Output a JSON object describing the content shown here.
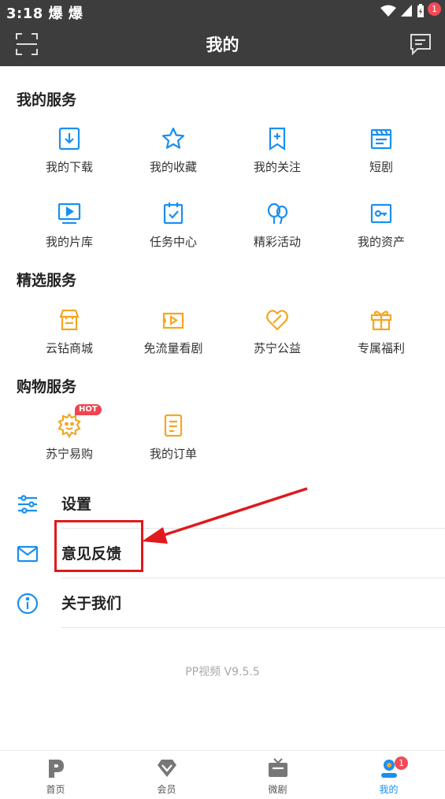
{
  "status_bar": {
    "time": "3:18",
    "notif_1": "爆",
    "notif_2": "爆"
  },
  "header": {
    "title": "我的",
    "message_badge": "1"
  },
  "services": {
    "title": "我的服务",
    "items": [
      {
        "label": "我的下载",
        "icon": "download-icon"
      },
      {
        "label": "我的收藏",
        "icon": "star-icon"
      },
      {
        "label": "我的关注",
        "icon": "bookmark-add-icon"
      },
      {
        "label": "短剧",
        "icon": "clapperboard-icon"
      },
      {
        "label": "我的片库",
        "icon": "tv-play-icon"
      },
      {
        "label": "任务中心",
        "icon": "task-check-icon"
      },
      {
        "label": "精彩活动",
        "icon": "balloon-icon"
      },
      {
        "label": "我的资产",
        "icon": "asset-card-icon"
      }
    ]
  },
  "featured": {
    "title": "精选服务",
    "items": [
      {
        "label": "云钻商城",
        "icon": "shop-icon"
      },
      {
        "label": "免流量看剧",
        "icon": "video-ticket-icon"
      },
      {
        "label": "苏宁公益",
        "icon": "charity-heart-icon"
      },
      {
        "label": "专属福利",
        "icon": "gift-icon"
      }
    ]
  },
  "shopping": {
    "title": "购物服务",
    "items": [
      {
        "label": "苏宁易购",
        "icon": "suning-lion-icon",
        "badge": "HOT"
      },
      {
        "label": "我的订单",
        "icon": "order-doc-icon"
      }
    ]
  },
  "list": [
    {
      "label": "设置",
      "icon": "settings-sliders-icon"
    },
    {
      "label": "意见反馈",
      "icon": "mail-icon"
    },
    {
      "label": "关于我们",
      "icon": "info-icon"
    }
  ],
  "version": "PP视频 V9.5.5",
  "tabs": [
    {
      "label": "首页",
      "icon": "pp-logo-icon"
    },
    {
      "label": "会员",
      "icon": "diamond-icon"
    },
    {
      "label": "微剧",
      "icon": "tv-icon"
    },
    {
      "label": "我的",
      "icon": "profile-icon",
      "badge": "1",
      "active": true
    }
  ],
  "colors": {
    "accent_blue": "#1a8ff2",
    "accent_orange": "#f5a623",
    "header_bg": "#3d3d3d",
    "badge_red": "#f24b58",
    "annotation_red": "#e0191d"
  }
}
